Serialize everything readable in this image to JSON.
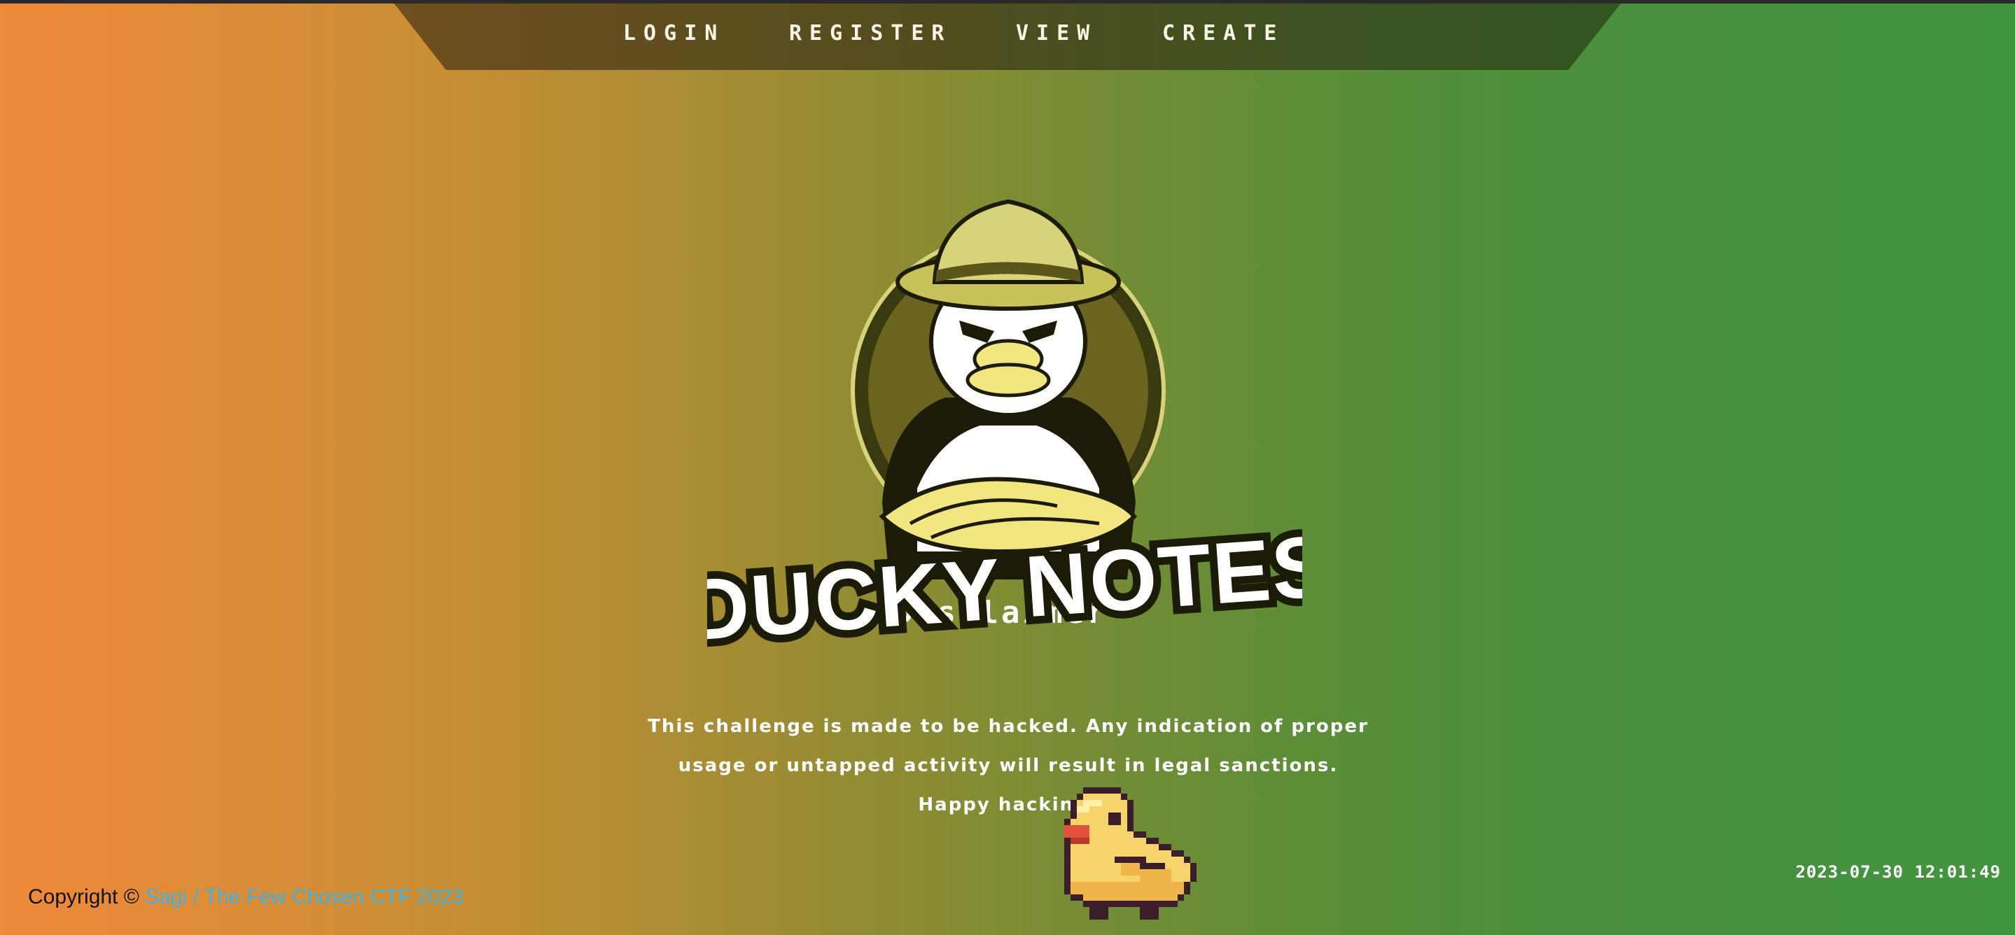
{
  "nav": {
    "items": [
      {
        "label": "LOGIN"
      },
      {
        "label": "REGISTER"
      },
      {
        "label": "VIEW"
      },
      {
        "label": "CREATE"
      }
    ]
  },
  "logo": {
    "text": "DUCKY NOTES"
  },
  "disclaimer": {
    "title": "Disclaimer",
    "line1": "This challenge is made to be hacked. Any indication of proper",
    "line2": "usage or untapped activity will result in legal sanctions.",
    "line3": "Happy hacking!"
  },
  "footer": {
    "copyright_prefix": "Copyright ©",
    "link_text": "Sagi / The Few Chosen CTF 2023"
  },
  "clock": {
    "datetime": "2023-07-30 12:01:49"
  },
  "colors": {
    "gradient_left": "#f0893a",
    "gradient_right": "#41953f",
    "nav_bg_left": "#6b4a1e",
    "nav_bg_right": "#2f5321",
    "link_blue": "#3fb3e6"
  }
}
